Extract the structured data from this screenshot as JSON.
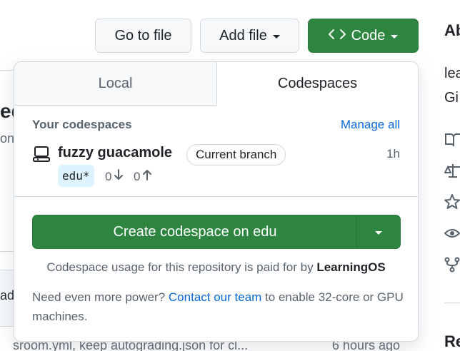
{
  "background": {
    "title_fragment": "ed",
    "subtitle_fragment": "on,",
    "row_fragment": "ad",
    "bottom_row": {
      "message": "sroom.yml, keep autograding.json for cl...",
      "time": "6 hours ago"
    }
  },
  "sidebar": {
    "heading": "About",
    "description_line1": "lea",
    "description_line2": "Gi",
    "next_heading": "Re",
    "icons": [
      "book-icon",
      "scale-icon",
      "star-icon",
      "eye-icon",
      "fork-icon"
    ]
  },
  "toolbar": {
    "go_to_file": "Go to file",
    "add_file": "Add file",
    "code": "Code"
  },
  "dropdown": {
    "tabs": [
      "Local",
      "Codespaces"
    ],
    "active_tab": "Codespaces",
    "section_heading": "Your codespaces",
    "manage_all": "Manage all",
    "codespace": {
      "name": "fuzzy guacamole",
      "badge": "Current branch",
      "age": "1h",
      "branch": "edu*",
      "behind": "0",
      "ahead": "0"
    },
    "create_button": "Create codespace on edu",
    "usage_prefix": "Codespace usage for this repository is paid for by",
    "usage_org": "LearningOS",
    "power_prefix": "Need even more power?",
    "power_link": "Contact our team",
    "power_suffix": "to enable 32-core or GPU machines."
  },
  "colors": {
    "primary_green": "#2e8540",
    "link_blue": "#0969da",
    "branch_bg": "#ddf4ff"
  }
}
